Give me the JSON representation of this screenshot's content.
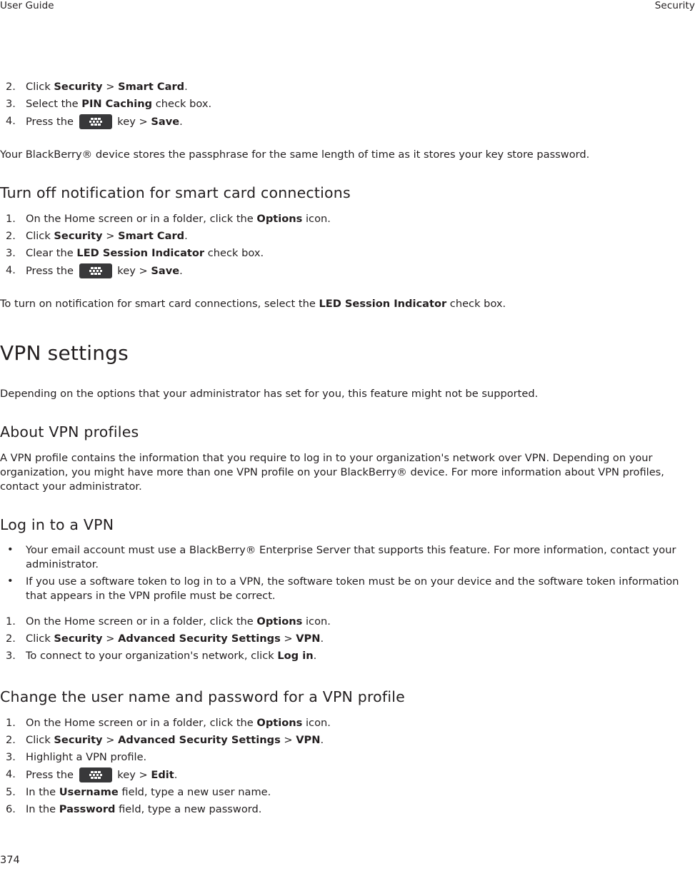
{
  "header": {
    "left": "User Guide",
    "right": "Security"
  },
  "footer": {
    "page_number": "374"
  },
  "icons": {
    "menu_key": "blackberry-menu-key-icon"
  },
  "sections": {
    "pin_caching_steps": {
      "item2": {
        "num": "2.",
        "pre": "Click ",
        "b1": "Security",
        "sep": " > ",
        "b2": "Smart Card",
        "post": "."
      },
      "item3": {
        "num": "3.",
        "pre": "Select the ",
        "b1": "PIN Caching",
        "post": " check box."
      },
      "item4": {
        "num": "4.",
        "pre": "Press the ",
        "mid": " key > ",
        "b1": "Save",
        "post": "."
      }
    },
    "pin_caching_note": "Your BlackBerry® device stores the passphrase for the same length of time as it stores your key store password.",
    "turn_off_notification": {
      "heading": "Turn off notification for smart card connections",
      "item1": {
        "num": "1.",
        "pre": "On the Home screen or in a folder, click the ",
        "b1": "Options",
        "post": " icon."
      },
      "item2": {
        "num": "2.",
        "pre": "Click ",
        "b1": "Security",
        "sep": " > ",
        "b2": "Smart Card",
        "post": "."
      },
      "item3": {
        "num": "3.",
        "pre": "Clear the ",
        "b1": "LED Session Indicator",
        "post": " check box."
      },
      "item4": {
        "num": "4.",
        "pre": "Press the ",
        "mid": " key > ",
        "b1": "Save",
        "post": "."
      },
      "note": {
        "pre": "To turn on notification for smart card connections, select the ",
        "b1": "LED Session Indicator",
        "post": " check box."
      }
    },
    "vpn_settings": {
      "heading": "VPN settings",
      "intro": "Depending on the options that your administrator has set for you, this feature might not be supported."
    },
    "about_vpn_profiles": {
      "heading": "About VPN profiles",
      "body": "A VPN profile contains the information that you require to log in to your organization's network over VPN. Depending on your organization, you might have more than one VPN profile on your BlackBerry® device. For more information about VPN profiles, contact your administrator."
    },
    "log_in_to_a_vpn": {
      "heading": "Log in to a VPN",
      "bullet1": "Your email account must use a BlackBerry® Enterprise Server that supports this feature. For more information, contact your administrator.",
      "bullet2": "If you use a software token to log in to a VPN, the software token must be on your device and the software token information that appears in the VPN profile must be correct.",
      "item1": {
        "num": "1.",
        "pre": "On the Home screen or in a folder, click the ",
        "b1": "Options",
        "post": " icon."
      },
      "item2": {
        "num": "2.",
        "pre": "Click ",
        "b1": "Security",
        "sep": " > ",
        "b2": "Advanced Security Settings",
        "sep2": " > ",
        "b3": "VPN",
        "post": "."
      },
      "item3": {
        "num": "3.",
        "pre": "To connect to your organization's network, click ",
        "b1": "Log in",
        "post": "."
      }
    },
    "change_user_name_password": {
      "heading": "Change the user name and password for a VPN profile",
      "item1": {
        "num": "1.",
        "pre": "On the Home screen or in a folder, click the ",
        "b1": "Options",
        "post": " icon."
      },
      "item2": {
        "num": "2.",
        "pre": "Click ",
        "b1": "Security",
        "sep": " > ",
        "b2": "Advanced Security Settings",
        "sep2": " > ",
        "b3": "VPN",
        "post": "."
      },
      "item3": {
        "num": "3.",
        "pre": "Highlight a VPN profile.",
        "post": ""
      },
      "item4": {
        "num": "4.",
        "pre": "Press the ",
        "mid": " key > ",
        "b1": "Edit",
        "post": "."
      },
      "item5": {
        "num": "5.",
        "pre": "In the ",
        "b1": "Username",
        "post": " field, type a new user name."
      },
      "item6": {
        "num": "6.",
        "pre": "In the ",
        "b1": "Password",
        "post": " field, type a new password."
      }
    }
  },
  "bullet_glyph": "•"
}
